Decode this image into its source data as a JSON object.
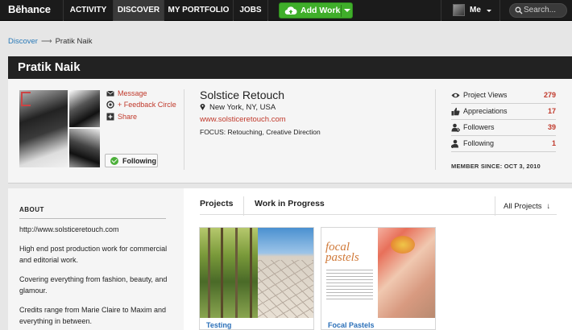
{
  "app": {
    "logo": "Bēhance"
  },
  "nav": {
    "items": [
      {
        "label": "ACTIVITY"
      },
      {
        "label": "DISCOVER"
      },
      {
        "label": "MY PORTFOLIO"
      },
      {
        "label": "JOBS"
      }
    ],
    "add_work": "Add Work",
    "me": "Me",
    "search_placeholder": "Search..."
  },
  "breadcrumb": {
    "root": "Discover",
    "arrow": "⟶",
    "current": "Pratik Naik"
  },
  "profile": {
    "name": "Pratik Naik",
    "actions": [
      {
        "label": "Message",
        "icon": "envelope-icon"
      },
      {
        "label": "+ Feedback Circle",
        "icon": "circle-icon"
      },
      {
        "label": "Share",
        "icon": "plus-box-icon"
      }
    ],
    "follow_label": "Following",
    "company": "Solstice Retouch",
    "location": "New York, NY, USA",
    "website": "www.solsticeretouch.com",
    "focus": "FOCUS: Retouching, Creative Direction",
    "stats": [
      {
        "label": "Project Views",
        "value": "279",
        "icon": "eye-icon"
      },
      {
        "label": "Appreciations",
        "value": "17",
        "icon": "thumbs-up-icon"
      },
      {
        "label": "Followers",
        "value": "39",
        "icon": "followers-icon"
      },
      {
        "label": "Following",
        "value": "1",
        "icon": "following-icon"
      }
    ],
    "member_since": "MEMBER SINCE: OCT 3, 2010"
  },
  "about": {
    "heading": "ABOUT",
    "paragraphs": [
      "http://www.solsticeretouch.com",
      "High end post production work for commercial and editorial work.",
      "Covering everything from fashion, beauty, and glamour.",
      "Credits range from Marie Claire to Maxim and everything in between."
    ]
  },
  "tabs": {
    "projects": "Projects",
    "wip": "Work in Progress",
    "filter": "All Projects",
    "filter_arrow": "↓"
  },
  "projects": [
    {
      "title": "Testing"
    },
    {
      "title": "Focal Pastels",
      "thumb_text": "focal pastels"
    }
  ],
  "colors": {
    "accent": "#c0392b",
    "link": "#2a6fb8",
    "add_work": "#3fae2a",
    "nav_bg": "#1b1b1b"
  }
}
